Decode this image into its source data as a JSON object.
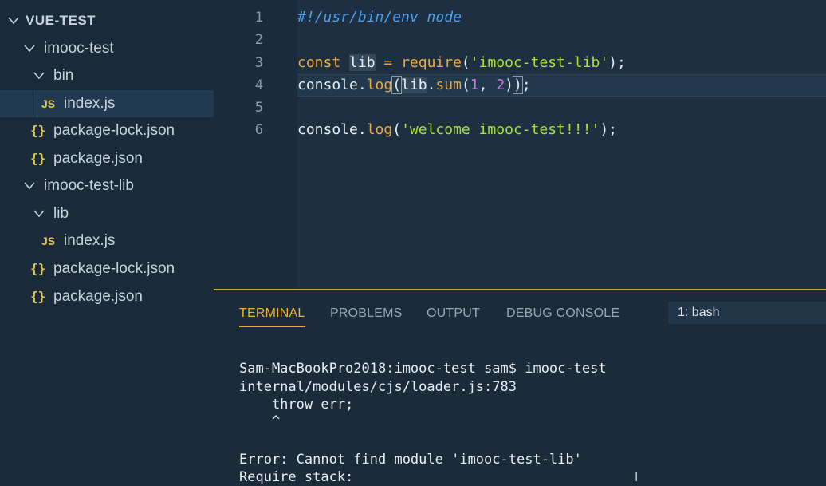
{
  "explorer": {
    "root": "VUE-TEST",
    "items": [
      {
        "label": "imooc-test",
        "kind": "folder"
      },
      {
        "label": "bin",
        "kind": "folder"
      },
      {
        "label": "index.js",
        "kind": "js",
        "selected": true
      },
      {
        "label": "package-lock.json",
        "kind": "json"
      },
      {
        "label": "package.json",
        "kind": "json"
      },
      {
        "label": "imooc-test-lib",
        "kind": "folder"
      },
      {
        "label": "lib",
        "kind": "folder"
      },
      {
        "label": "index.js",
        "kind": "js"
      },
      {
        "label": "package-lock.json",
        "kind": "json"
      },
      {
        "label": "package.json",
        "kind": "json"
      }
    ],
    "js_badge": "JS",
    "json_badge": "{}"
  },
  "editor": {
    "line_numbers": [
      "1",
      "2",
      "3",
      "4",
      "5",
      "6"
    ],
    "lines": {
      "l1": "#!/usr/bin/env node",
      "l3_kw": "const",
      "l3_var": "lib",
      "l3_eq": " = ",
      "l3_fn": "require",
      "l3_open": "(",
      "l3_str": "'imooc-test-lib'",
      "l3_close": ");",
      "l4_obj": "console",
      "l4_dot": ".",
      "l4_fn": "log",
      "l4_open": "(",
      "l4_var": "lib",
      "l4_dot2": ".",
      "l4_fn2": "sum",
      "l4_open2": "(",
      "l4_n1": "1",
      "l4_comma": ", ",
      "l4_n2": "2",
      "l4_close2": ")",
      "l4_close": ")",
      "l4_semi": ";",
      "l6_obj": "console",
      "l6_dot": ".",
      "l6_fn": "log",
      "l6_open": "(",
      "l6_str": "'welcome imooc-test!!!'",
      "l6_close": ");"
    }
  },
  "panel": {
    "tabs": [
      "TERMINAL",
      "PROBLEMS",
      "OUTPUT",
      "DEBUG CONSOLE"
    ],
    "active_tab": "TERMINAL",
    "terminal_select": "1: bash",
    "terminal_lines": [
      "Sam-MacBookPro2018:imooc-test sam$ imooc-test",
      "internal/modules/cjs/loader.js:783",
      "    throw err;",
      "    ^",
      "Error: Cannot find module 'imooc-test-lib'",
      "Require stack:"
    ]
  },
  "colors": {
    "accent": "#e8b23a",
    "string": "#a6e22e",
    "keyword": "#f2a736",
    "number": "#c678dd",
    "comment": "#4a9ff5"
  }
}
